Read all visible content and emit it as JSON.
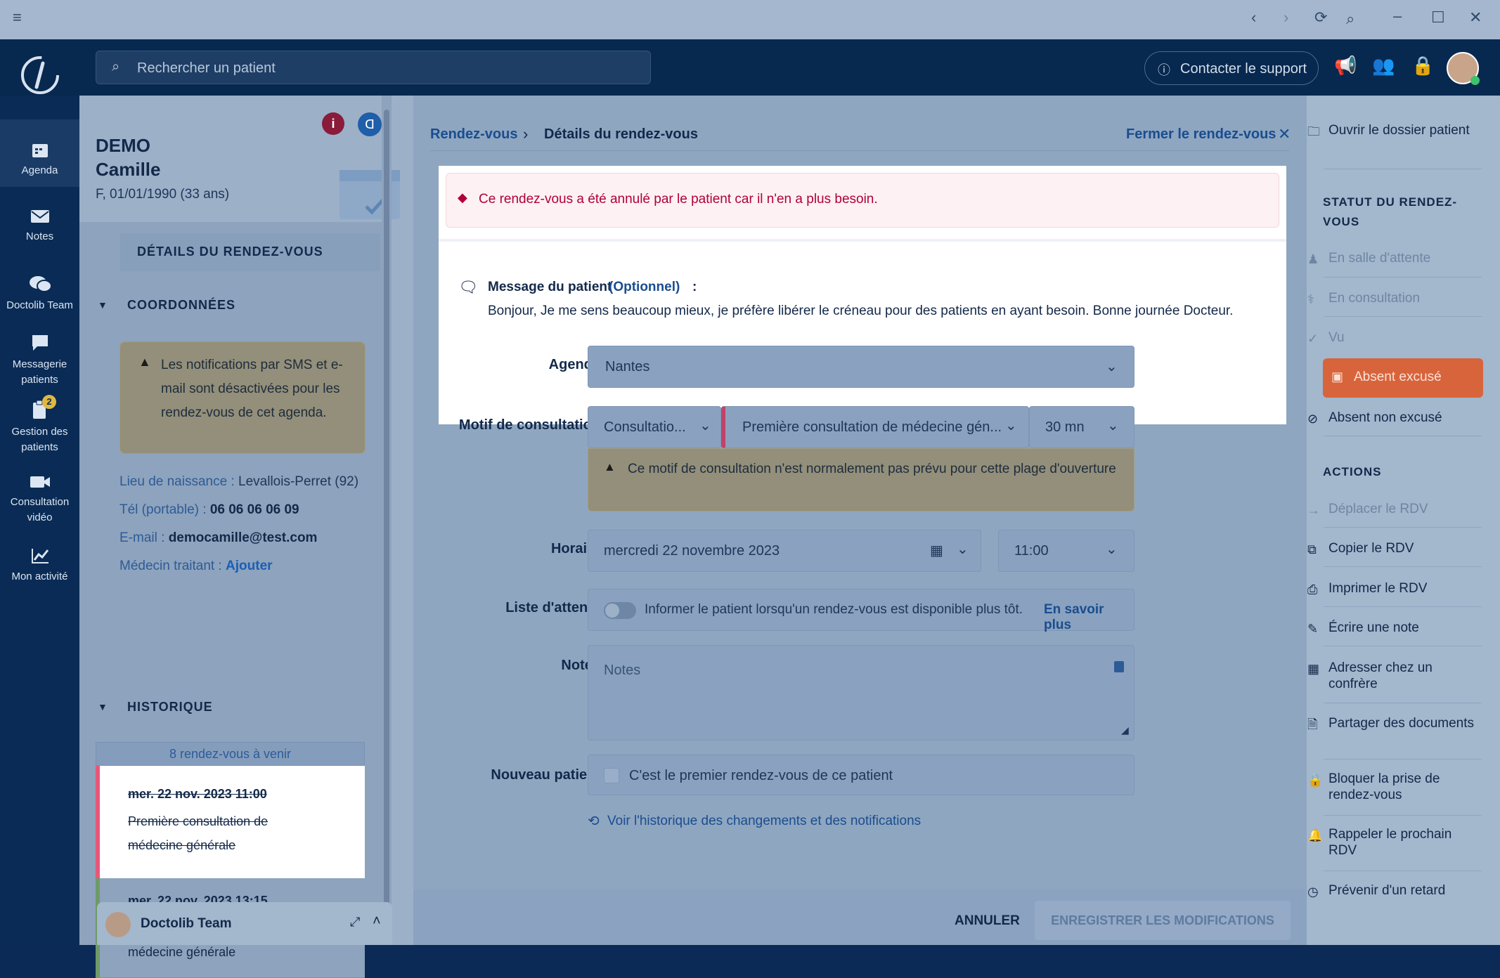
{
  "topbar": {
    "search_placeholder": "Rechercher un patient",
    "support_label": "Contacter le support"
  },
  "nav": [
    {
      "label": "Agenda",
      "icon": "calendar-icon"
    },
    {
      "label": "Notes",
      "icon": "envelope-icon"
    },
    {
      "label": "Doctolib Team",
      "icon": "chat-bubbles-icon"
    },
    {
      "label": "Messagerie patients",
      "icon": "message-icon"
    },
    {
      "label": "Gestion des patients",
      "icon": "clipboard-icon",
      "badge": "2"
    },
    {
      "label": "Consultation vidéo",
      "icon": "video-icon"
    },
    {
      "label": "Mon activité",
      "icon": "chart-line-icon"
    }
  ],
  "patient": {
    "last_name": "DEMO",
    "first_name": "Camille",
    "info": "F, 01/01/1990 (33 ans)",
    "details_header": "DÉTAILS DU RENDEZ-VOUS",
    "coord_header": "COORDONNÉES",
    "notice": "Les notifications par SMS et e-mail sont désactivées pour les rendez-vous de cet agenda.",
    "birthplace_label": "Lieu de naissance :",
    "birthplace": "Levallois-Perret (92)",
    "phone_label": "Tél (portable) :",
    "phone": "06 06 06 06 09",
    "email_label": "E-mail :",
    "email": "democamille@test.com",
    "doctor_label": "Médecin traitant :",
    "doctor_action": "Ajouter",
    "history_header": "HISTORIQUE",
    "upcoming": "8 rendez-vous à venir",
    "appointments": [
      {
        "date": "mer. 22 nov. 2023 11:00",
        "motif": "Première consultation de médecine générale",
        "cancelled": true
      },
      {
        "date": "mer. 22 nov. 2023 13:15",
        "motif": "Consultation de suivi de médecine générale",
        "cancelled": false
      }
    ],
    "team_label": "Doctolib Team"
  },
  "main": {
    "breadcrumb_root": "Rendez-vous",
    "breadcrumb_current": "Détails du rendez-vous",
    "close_label": "Fermer le rendez-vous",
    "cancel_alert": "Ce rendez-vous a été annulé par le patient car il n'en a plus besoin.",
    "message_title": "Message du patient",
    "message_optional": "(Optionnel)",
    "message_text": "Bonjour, Je me sens beaucoup mieux, je préfère libérer le créneau pour des patients en ayant besoin. Bonne journée Docteur.",
    "agenda_label": "Agenda",
    "agenda_value": "Nantes",
    "motif_label": "Motif de consultation",
    "motif_type": "Consultatio...",
    "motif_value": "Première consultation de médecine gén...",
    "duration": "30 mn",
    "motif_warning": "Ce motif de consultation n'est normalement pas prévu pour cette plage d'ouverture",
    "horaire_label": "Horaire",
    "date_value": "mercredi 22 novembre 2023",
    "time_value": "11:00",
    "waitlist_label": "Liste d'attente",
    "waitlist_text": "Informer le patient lorsqu'un rendez-vous est disponible plus tôt.",
    "waitlist_link": "En savoir plus",
    "notes_label": "Notes",
    "notes_placeholder": "Notes",
    "newpatient_label": "Nouveau patient",
    "newpatient_text": "C'est le premier rendez-vous de ce patient",
    "history_link": "Voir l'historique des changements et des notifications",
    "cancel_btn": "ANNULER",
    "save_btn": "ENREGISTRER LES MODIFICATIONS"
  },
  "right": {
    "open_file": "Ouvrir le dossier patient",
    "status_header": "STATUT DU RENDEZ-VOUS",
    "statuses": [
      "En salle d'attente",
      "En consultation",
      "Vu",
      "Absent excusé",
      "Absent non excusé"
    ],
    "actions_header": "ACTIONS",
    "actions": [
      "Déplacer le RDV",
      "Copier le RDV",
      "Imprimer le RDV",
      "Écrire une note",
      "Adresser chez un confrère",
      "Partager des documents",
      "Bloquer la prise de rendez-vous",
      "Rappeler le prochain RDV",
      "Prévenir d'un retard"
    ]
  },
  "colors": {
    "accent": "#d8643c",
    "danger": "#b0003a",
    "link": "#1a5fb4",
    "navy": "#07284f"
  }
}
